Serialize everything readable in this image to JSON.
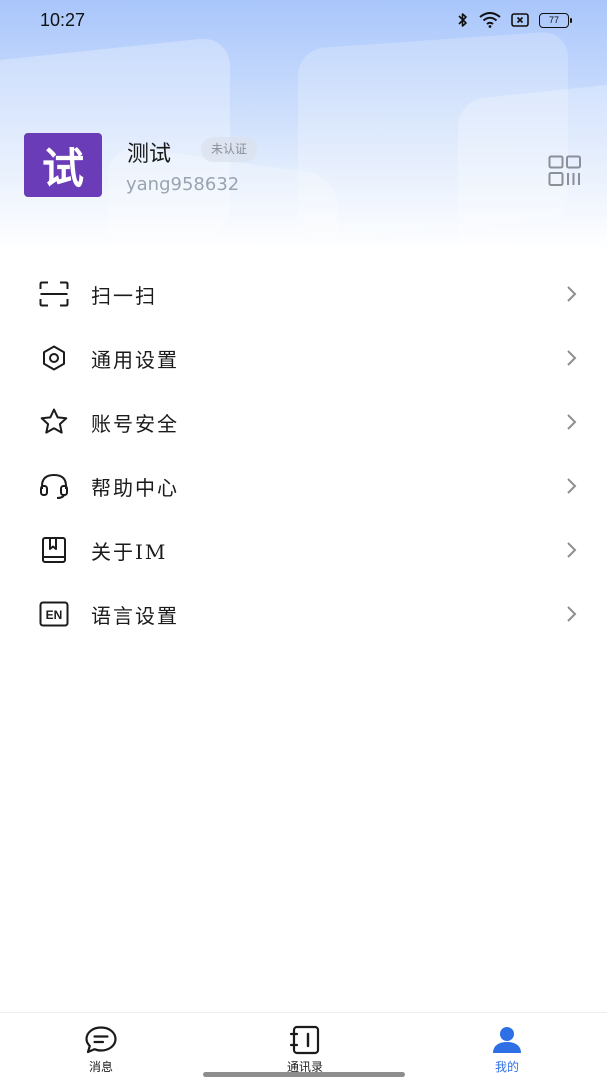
{
  "status_bar": {
    "time": "10:27",
    "battery_level": "77"
  },
  "profile": {
    "avatar_text": "试",
    "avatar_color": "#6a3cb8",
    "nickname": "测试",
    "verify_status": "未认证",
    "user_id": "yang958632"
  },
  "menu": {
    "items": [
      {
        "label": "扫一扫",
        "icon": "scan-icon"
      },
      {
        "label": "通用设置",
        "icon": "settings-hexagon-icon"
      },
      {
        "label": "账号安全",
        "icon": "star-icon"
      },
      {
        "label": "帮助中心",
        "icon": "headset-icon"
      },
      {
        "label": "关于IM",
        "icon": "book-icon"
      },
      {
        "label": "语言设置",
        "icon": "language-en-icon"
      }
    ]
  },
  "bottom_nav": {
    "items": [
      {
        "label": "消息",
        "icon": "message-icon"
      },
      {
        "label": "通讯录",
        "icon": "contacts-icon"
      },
      {
        "label": "我的",
        "icon": "profile-icon"
      }
    ],
    "active_color": "#2f6fe6"
  }
}
